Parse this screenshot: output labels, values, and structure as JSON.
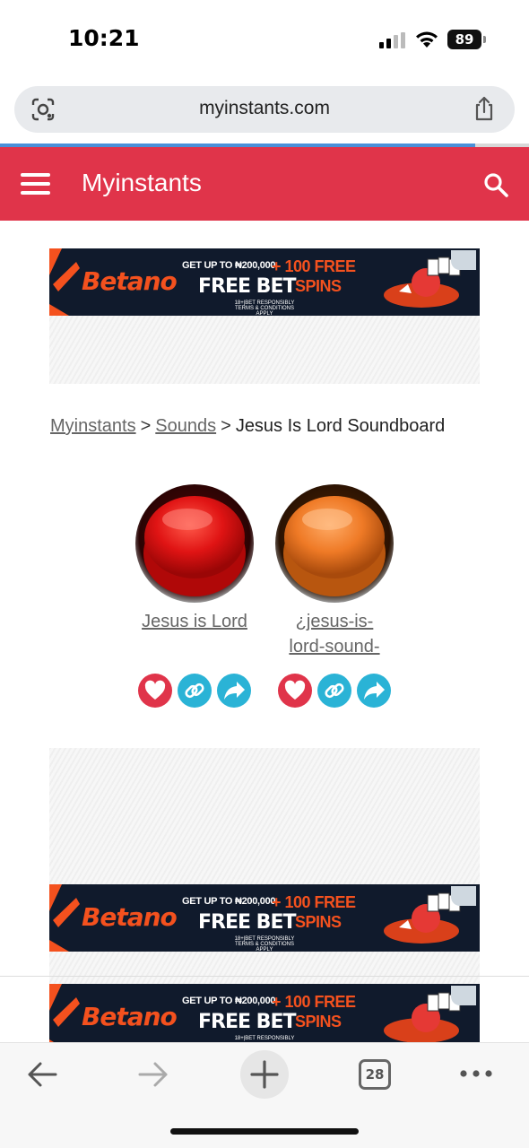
{
  "status_bar": {
    "time": "10:21",
    "battery": "89"
  },
  "browser": {
    "url": "myinstants.com",
    "tab_count": "28"
  },
  "site": {
    "title": "Myinstants",
    "accent_color": "#e0344a"
  },
  "ad": {
    "brand": "Betano",
    "headline_small": "GET UP TO ₦200,000",
    "headline_plus": "+ 100 FREE",
    "headline_main": "FREE BET",
    "headline_spins": "SPINS",
    "fine_print_1": "18+|BET RESPONSIBLY",
    "fine_print_2": "TERMS & CONDITIONS APPLY"
  },
  "breadcrumb": {
    "home": "Myinstants",
    "sep1": ">",
    "sounds": "Sounds",
    "sep2": ">",
    "current": "Jesus Is Lord Soundboard"
  },
  "sounds": [
    {
      "label": "Jesus is Lord",
      "color": "red"
    },
    {
      "label_line1": "¿jesus-is-",
      "label_line2": "lord-sound-",
      "color": "orange"
    }
  ]
}
